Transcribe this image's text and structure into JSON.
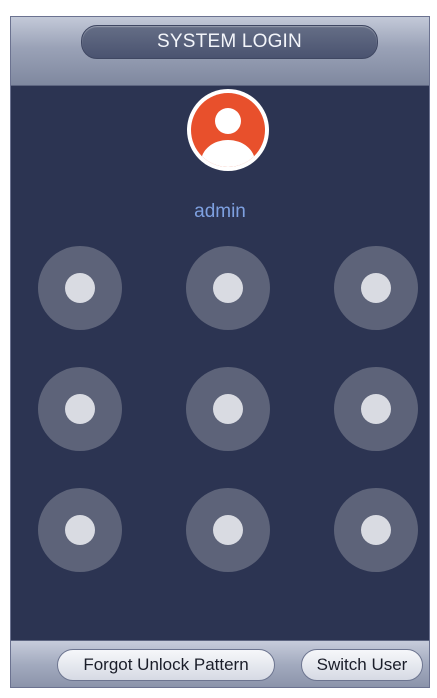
{
  "header": {
    "title": "SYSTEM LOGIN"
  },
  "user": {
    "name": "admin",
    "avatar_icon": "user-avatar-icon"
  },
  "pattern": {
    "rows": 3,
    "cols": 3,
    "dot_color": "#5d6379",
    "dot_core_color": "#d9dbe2"
  },
  "footer": {
    "forgot_label": "Forgot Unlock Pattern",
    "switch_label": "Switch User"
  },
  "colors": {
    "background": "#2c3452",
    "username": "#7ea0e0",
    "avatar_red": "#e8502c"
  }
}
